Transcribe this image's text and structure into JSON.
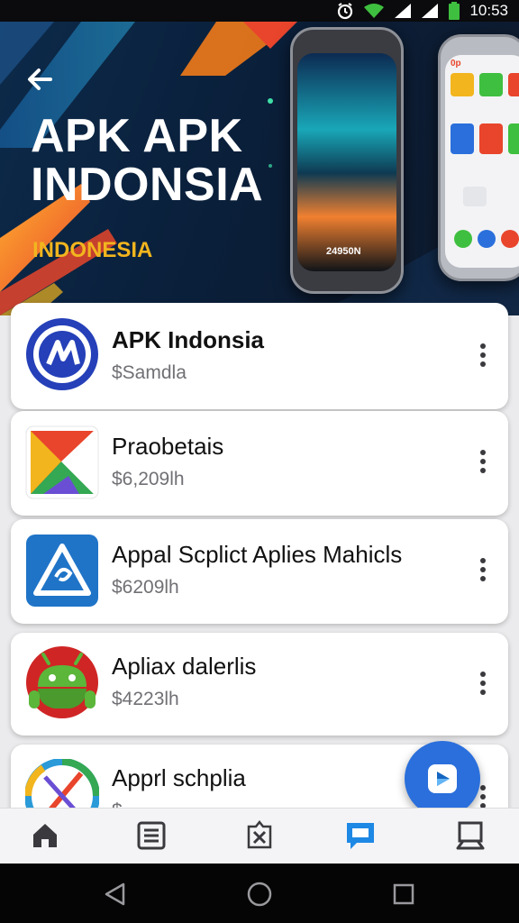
{
  "status_bar": {
    "time": "10:53",
    "icons": [
      "alarm-icon",
      "wifi-icon",
      "signal-icon",
      "signal-icon",
      "battery-icon"
    ]
  },
  "hero": {
    "title_line1": "APK APK",
    "title_line2": "INDONSIA",
    "subtitle": "INDONESIA",
    "phone_left_caption": "24950N",
    "phone_right_chip": "0p",
    "accent_colors": [
      "#f2b51e",
      "#e8452c",
      "#2aa5d8",
      "#f07a1a"
    ]
  },
  "apps": [
    {
      "name": "APK Indonsia",
      "price": "$Samdla",
      "icon": "apk-indonesia-logo-icon"
    },
    {
      "name": "Praobetais",
      "price": "$6,209lh",
      "icon": "play-triangle-logo-icon"
    },
    {
      "name": "Appal Scplict Aplies Mahicls",
      "price": "$6209lh",
      "icon": "triangle-sign-logo-icon"
    },
    {
      "name": "Apliax dalerlis",
      "price": "$4223lh",
      "icon": "android-robot-icon"
    },
    {
      "name": "Apprl schplia",
      "price": "$ ",
      "icon": "colorful-pen-logo-icon"
    }
  ],
  "fab": {
    "icon": "app-store-icon",
    "color": "#2a6fdc"
  },
  "bottom_nav": {
    "items": [
      "home-icon",
      "list-icon",
      "shield-star-icon",
      "chat-icon",
      "profile-icon"
    ],
    "active_index": 3,
    "active_color": "#1e88e5"
  },
  "system_nav": {
    "items": [
      "back-triangle-icon",
      "home-circle-icon",
      "recents-square-icon"
    ]
  }
}
